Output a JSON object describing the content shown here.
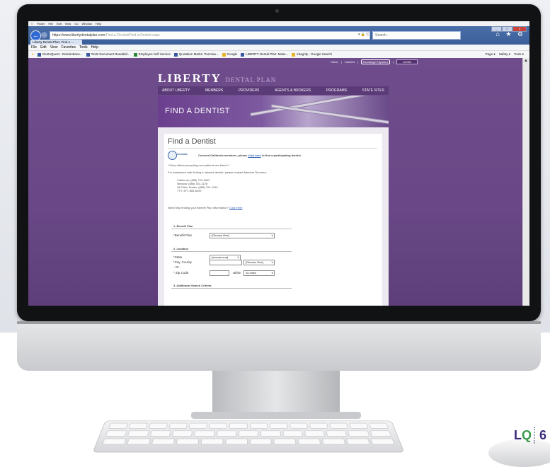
{
  "mac_menu": [
    "Finder",
    "File",
    "Edit",
    "View",
    "Go",
    "Window",
    "Help"
  ],
  "browser": {
    "url_main": "https://www.libertydentalplan.com",
    "url_rest": "/Find-a-Dentist/Find-a-Dentist.aspx",
    "search_placeholder": "Search...",
    "tab_title": "Liberty Dental Plan: Find A ...",
    "menu": [
      "File",
      "Edit",
      "View",
      "Favorites",
      "Tools",
      "Help"
    ],
    "favorites": [
      "DentoQuest - Dental Bene...",
      "Tests Document Readabil...",
      "Employee Self Service",
      "Quotation Marks: Punctua...",
      "Google",
      "LIBERTY Dental Plan: Mass...",
      "integrity - Google Search"
    ],
    "tools": [
      "Page ▾",
      "Safety ▾",
      "Tools ▾"
    ]
  },
  "site": {
    "util": [
      "Home",
      "Careers",
      "Exchange Payment",
      "LOGIN"
    ],
    "logo_main": "LIBERTY",
    "logo_sub": "DENTAL PLAN",
    "nav": [
      "ABOUT LIBERTY",
      "MEMBERS",
      "PROVIDERS",
      "AGENTS & BROKERS",
      "PROGRAMS",
      "STATE SITES"
    ],
    "banner_title": "FIND A DENTIST"
  },
  "page": {
    "heading": "Find a Dentist",
    "seal_text": "COVERED",
    "covered_text": "Covered California members, please",
    "covered_link": "click here",
    "covered_tail": "to find a participating dentist.",
    "only_offices": "**Only offices accepting new patients are listed.**",
    "assist": "For assistance with finding a network dentist, please contact Member Services:",
    "phones": [
      "California: (888) 703-6999",
      "Nevada: (888) 401-1128",
      "All Other States: (888) 704-1249",
      "TTY: 877-855-8039"
    ],
    "help_text": "Need help finding your Benefit Plan information?",
    "help_link": "Click Here",
    "sec1": "1. Benefit Plan",
    "benefit_label": "*Benefit Plan",
    "benefit_value": "[Choose One]",
    "sec2": "2. Location",
    "state_label": "*State",
    "state_value": "[choose one]",
    "city_label": "*City, County",
    "city_value": "[Choose One]",
    "or_label": "- Or -",
    "zip_label": "* Zip Code",
    "within_label": "within",
    "miles_value": "10 miles",
    "sec3": "3. Additional Search Criteria"
  },
  "brand": {
    "lq_l": "L",
    "lq_q": "Q",
    "page_number": "6"
  }
}
